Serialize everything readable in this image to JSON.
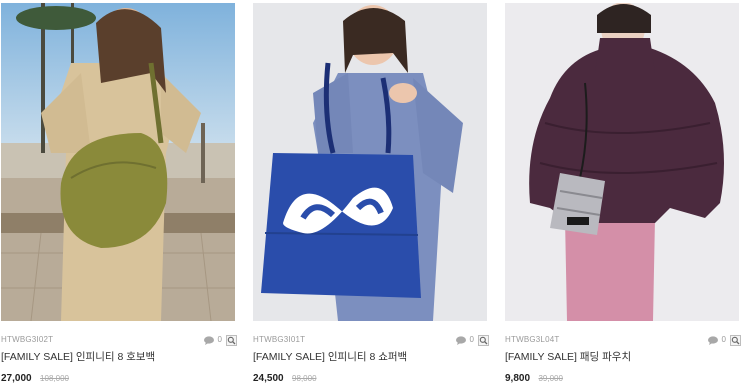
{
  "products": [
    {
      "code": "HTWBG3I02T",
      "name": "[FAMILY SALE] 인피니티 8 호보백",
      "price": "27,000",
      "original_price": "108,000",
      "comments": "0"
    },
    {
      "code": "HTWBG3I01T",
      "name": "[FAMILY SALE] 인피니티 8 쇼퍼백",
      "price": "24,500",
      "original_price": "98,000",
      "comments": "0"
    },
    {
      "code": "HTWBG3L04T",
      "name": "[FAMILY SALE] 패딩 파우치",
      "price": "9,800",
      "original_price": "39,000",
      "comments": "0"
    }
  ],
  "icons": {
    "comment": "speech-bubble-icon",
    "zoom": "magnifier-icon"
  },
  "colors": {
    "price": "#222222",
    "original_price": "#aaaaaa",
    "code": "#9a9a9a"
  }
}
